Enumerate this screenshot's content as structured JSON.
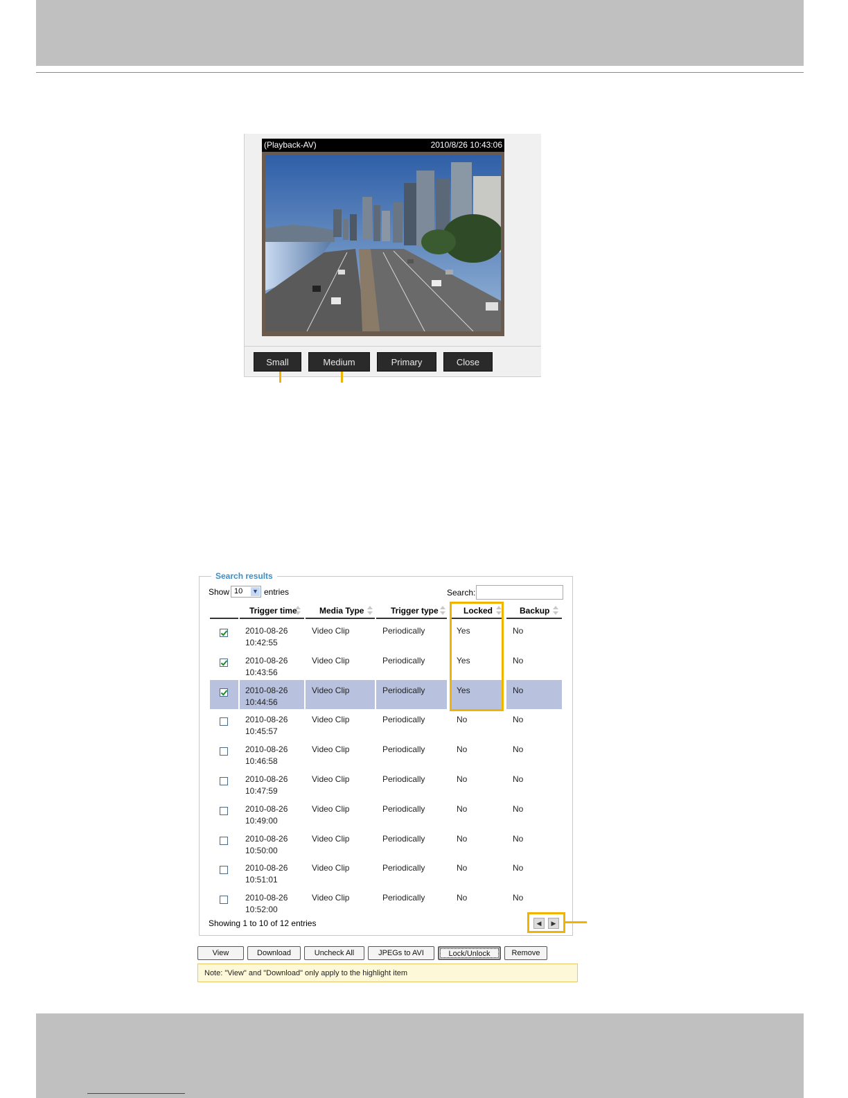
{
  "playback": {
    "title": "(Playback-AV)",
    "timestamp": "2010/8/26 10:43:06",
    "buttons": [
      "Small",
      "Medium",
      "Primary",
      "Close"
    ]
  },
  "results": {
    "legend": "Search results",
    "show_label": "Show",
    "show_value": "10",
    "entries_label": "entries",
    "search_label": "Search:",
    "headers": [
      "Trigger time",
      "Media Type",
      "Trigger type",
      "Locked",
      "Backup"
    ],
    "rows": [
      {
        "checked": true,
        "date": "2010-08-26",
        "time": "10:42:55",
        "media": "Video Clip",
        "trigger": "Periodically",
        "locked": "Yes",
        "backup": "No"
      },
      {
        "checked": true,
        "date": "2010-08-26",
        "time": "10:43:56",
        "media": "Video Clip",
        "trigger": "Periodically",
        "locked": "Yes",
        "backup": "No"
      },
      {
        "checked": true,
        "date": "2010-08-26",
        "time": "10:44:56",
        "media": "Video Clip",
        "trigger": "Periodically",
        "locked": "Yes",
        "backup": "No"
      },
      {
        "checked": false,
        "date": "2010-08-26",
        "time": "10:45:57",
        "media": "Video Clip",
        "trigger": "Periodically",
        "locked": "No",
        "backup": "No"
      },
      {
        "checked": false,
        "date": "2010-08-26",
        "time": "10:46:58",
        "media": "Video Clip",
        "trigger": "Periodically",
        "locked": "No",
        "backup": "No"
      },
      {
        "checked": false,
        "date": "2010-08-26",
        "time": "10:47:59",
        "media": "Video Clip",
        "trigger": "Periodically",
        "locked": "No",
        "backup": "No"
      },
      {
        "checked": false,
        "date": "2010-08-26",
        "time": "10:49:00",
        "media": "Video Clip",
        "trigger": "Periodically",
        "locked": "No",
        "backup": "No"
      },
      {
        "checked": false,
        "date": "2010-08-26",
        "time": "10:50:00",
        "media": "Video Clip",
        "trigger": "Periodically",
        "locked": "No",
        "backup": "No"
      },
      {
        "checked": false,
        "date": "2010-08-26",
        "time": "10:51:01",
        "media": "Video Clip",
        "trigger": "Periodically",
        "locked": "No",
        "backup": "No"
      },
      {
        "checked": false,
        "date": "2010-08-26",
        "time": "10:52:00",
        "media": "Video Clip",
        "trigger": "Periodically",
        "locked": "No",
        "backup": "No"
      }
    ],
    "summary": "Showing 1 to 10 of 12 entries"
  },
  "actions": [
    "View",
    "Download",
    "Uncheck All",
    "JPEGs to AVI",
    "Lock/Unlock",
    "Remove"
  ],
  "note": "Note: \"View\" and \"Download\" only apply to the highlight item",
  "colors": {
    "callout": "#f0b400",
    "highlight_row": "#b8c2de",
    "legend": "#3b8ec8"
  }
}
